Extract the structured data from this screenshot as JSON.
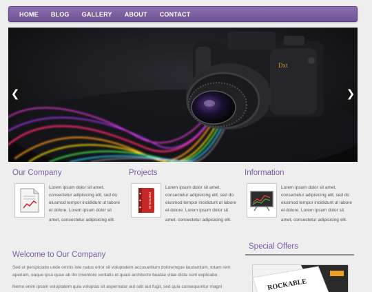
{
  "nav": {
    "items": [
      {
        "label": "HOME"
      },
      {
        "label": "BLOG"
      },
      {
        "label": "GALLERY"
      },
      {
        "label": "ABOUT"
      },
      {
        "label": "CONTACT"
      }
    ]
  },
  "hero": {
    "prev_label": "❮",
    "next_label": "❯",
    "camera_brand": "Dxt",
    "colors": {
      "background": "#0c0c0f",
      "streaks": [
        "#ff2a6a",
        "#ff9a1a",
        "#ffe600",
        "#3de84a",
        "#28c8ff",
        "#b23dff",
        "#ff3df0"
      ]
    }
  },
  "features": [
    {
      "title": "Our Company",
      "icon": "chart-document-icon",
      "lines": [
        "Lorem ipsum dolor sit amet,",
        "consectetur adipisicing elit, sed do",
        "eiusmod tempor incididunt ut labore",
        "et dolore. Lorem ipsum dolor sit",
        "amet, consectetur adipisicing elit."
      ]
    },
    {
      "title": "Projects",
      "icon": "portfolio-binder-icon",
      "binder_label": "PORTFOLIO",
      "lines": [
        "Lorem ipsum dolor sit amet,",
        "consectetur adipisicing elit, sed do",
        "eiusmod tempor incididunt ut labore",
        "et dolore. Lorem ipsum dolor sit",
        "amet, consectetur adipisicing elit."
      ]
    },
    {
      "title": "Information",
      "icon": "chart-board-icon",
      "lines": [
        "Lorem ipsum dolor sit amet,",
        "consectetur adipisicing elit, sed do",
        "eiusmod tempor incididunt ut labore",
        "et dolore. Lorem ipsum dolor sit",
        "amet, consectetur adipisicing elit."
      ]
    }
  ],
  "welcome": {
    "title": "Welcome to Our Company",
    "lines": [
      "Sed ut perspiciatis unde omnis iste natus error sit voluptatem accusantium doloremque laudantium, totam rem",
      "aperiam, eaque ipsa quae ab illo inventore veritatis et quasi architecto beatae vitae dicta sunt explicabo.",
      "Nemo enim ipsam voluptatem quia voluptas sit aspernatur aut odit aut fugit, sed quia consequuntur magni"
    ]
  },
  "offers": {
    "title": "Special Offers",
    "card_text": "ROCKABLE"
  },
  "colors": {
    "accent": "#7a5fa6",
    "nav_top": "#8a6fae",
    "nav_bottom": "#6f5294",
    "page_bg": "#eeeeee"
  }
}
